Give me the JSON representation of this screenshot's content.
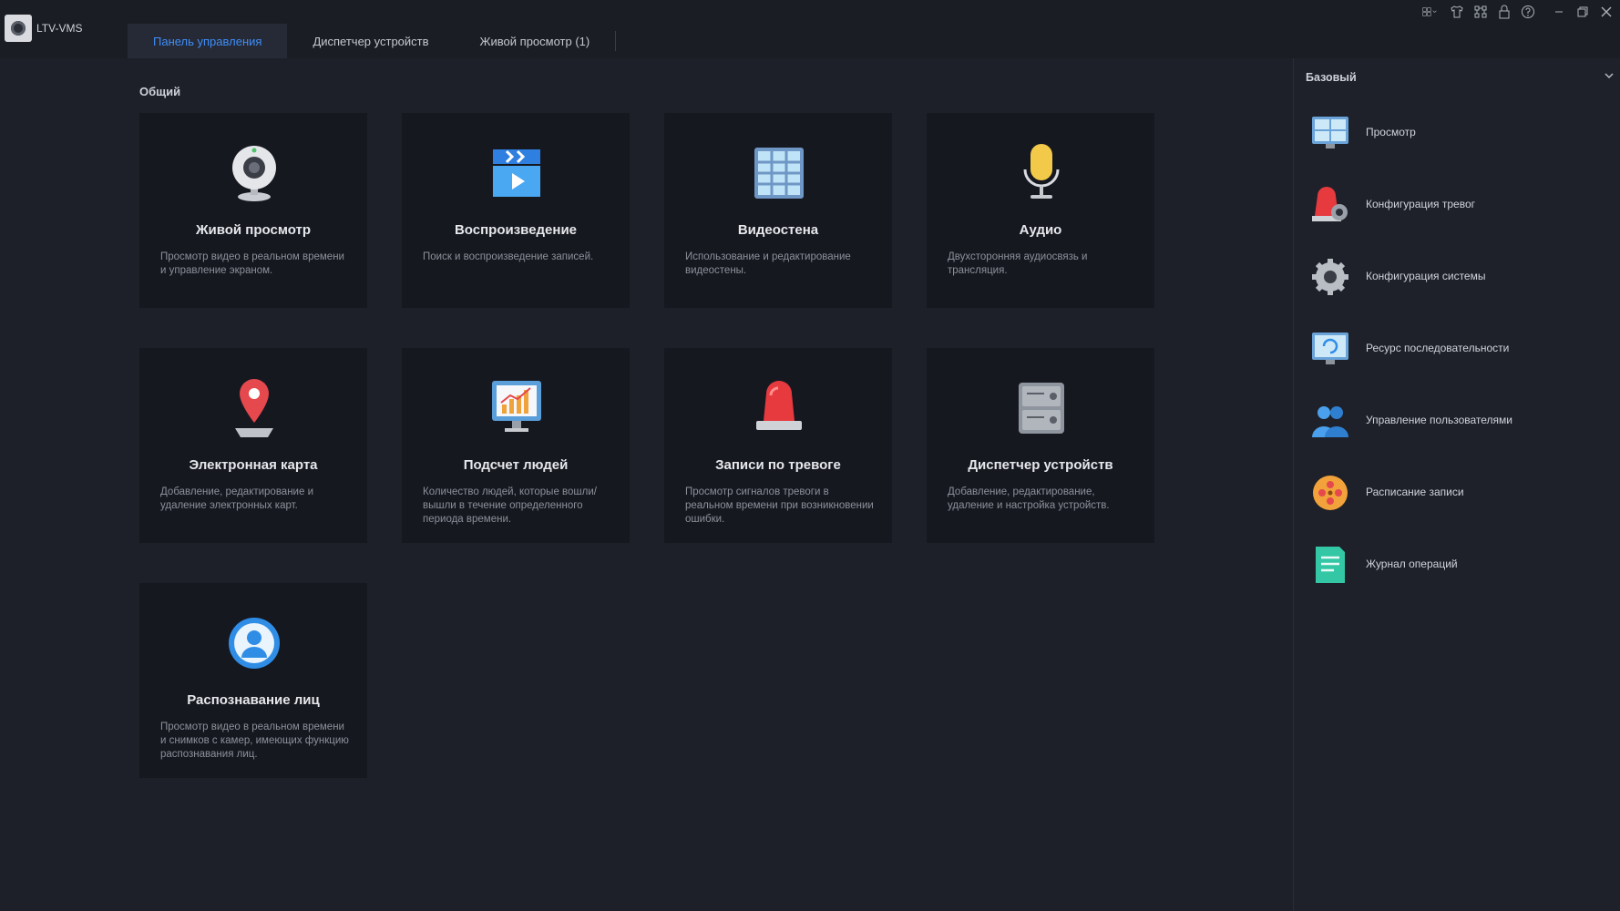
{
  "app": {
    "name": "LTV-VMS"
  },
  "tabs": [
    {
      "label": "Панель управления",
      "active": true
    },
    {
      "label": "Диспетчер устройств",
      "active": false
    },
    {
      "label": "Живой просмотр (1)",
      "active": false
    }
  ],
  "window_controls": [
    "layout-grid-icon",
    "shirt-icon",
    "network-icon",
    "lock-icon",
    "help-icon",
    "minimize-icon",
    "restore-icon",
    "close-icon"
  ],
  "section": {
    "title": "Общий"
  },
  "cards": [
    {
      "title": "Живой просмотр",
      "desc": "Просмотр видео в реальном времени и управление экраном.",
      "icon": "webcam-icon"
    },
    {
      "title": "Воспроизведение",
      "desc": "Поиск и воспроизведение записей.",
      "icon": "playback-clapper-icon"
    },
    {
      "title": "Видеостена",
      "desc": "Использование и редактирование видеостены.",
      "icon": "video-wall-icon"
    },
    {
      "title": "Аудио",
      "desc": "Двухсторонняя аудиосвязь и трансляция.",
      "icon": "microphone-icon"
    },
    {
      "title": "Электронная карта",
      "desc": "Добавление, редактирование и удаление электронных карт.",
      "icon": "map-pin-icon"
    },
    {
      "title": "Подсчет людей",
      "desc": "Количество людей, которые вошли/вышли в течение определенного периода времени.",
      "icon": "people-count-chart-icon"
    },
    {
      "title": "Записи по тревоге",
      "desc": "Просмотр сигналов тревоги в реальном времени при возникновении ошибки.",
      "icon": "alarm-siren-icon"
    },
    {
      "title": "Диспетчер устройств",
      "desc": "Добавление, редактирование, удаление и настройка устройств.",
      "icon": "server-icon"
    },
    {
      "title": "Распознавание лиц",
      "desc": "Просмотр видео в реальном времени и снимков с камер, имеющих функцию распознавания лиц.",
      "icon": "face-recognition-icon"
    }
  ],
  "right_panel": {
    "title": "Базовый",
    "items": [
      {
        "label": "Просмотр",
        "icon": "monitor-view-icon"
      },
      {
        "label": "Конфигурация тревог",
        "icon": "alarm-config-icon"
      },
      {
        "label": "Конфигурация системы",
        "icon": "system-gear-icon"
      },
      {
        "label": "Ресурс последовательности",
        "icon": "sequence-monitor-icon"
      },
      {
        "label": "Управление пользователями",
        "icon": "users-icon"
      },
      {
        "label": "Расписание записи",
        "icon": "record-schedule-icon"
      },
      {
        "label": "Журнал операций",
        "icon": "operation-log-icon"
      }
    ]
  },
  "colors": {
    "accent": "#3f8ef7",
    "background": "#1d2029",
    "card": "#161820"
  }
}
